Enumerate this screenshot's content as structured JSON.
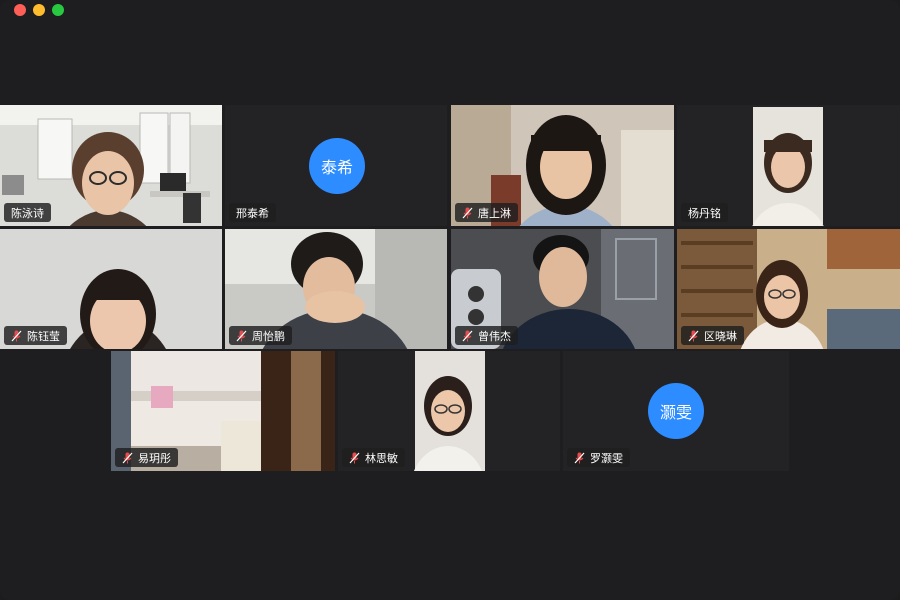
{
  "window": {
    "controls": [
      "close",
      "minimize",
      "zoom"
    ]
  },
  "participants": [
    {
      "name": "陈泳诗",
      "muted": false,
      "video": true,
      "active_speaker": false
    },
    {
      "name": "邢泰希",
      "muted": false,
      "video": false,
      "avatar_text": "泰希",
      "avatar_color": "#2d8cff",
      "active_speaker": false
    },
    {
      "name": "唐上淋",
      "muted": true,
      "video": true,
      "active_speaker": false
    },
    {
      "name": "杨丹铭",
      "muted": false,
      "video": true,
      "active_speaker": true
    },
    {
      "name": "陈钰莹",
      "muted": true,
      "video": true,
      "active_speaker": false
    },
    {
      "name": "周怡鹏",
      "muted": true,
      "video": true,
      "active_speaker": false
    },
    {
      "name": "曾伟杰",
      "muted": true,
      "video": true,
      "active_speaker": false
    },
    {
      "name": "区晓琳",
      "muted": true,
      "video": true,
      "active_speaker": false
    },
    {
      "name": "易玥彤",
      "muted": true,
      "video": true,
      "active_speaker": false
    },
    {
      "name": "林思敏",
      "muted": true,
      "video": true,
      "active_speaker": false
    },
    {
      "name": "罗灏雯",
      "muted": true,
      "video": false,
      "avatar_text": "灏雯",
      "avatar_color": "#2d8cff",
      "active_speaker": false
    }
  ],
  "colors": {
    "background": "#1e1e20",
    "tile": "#232325",
    "active_border": "#2fbb4f",
    "muted_icon": "#e84b4b"
  }
}
